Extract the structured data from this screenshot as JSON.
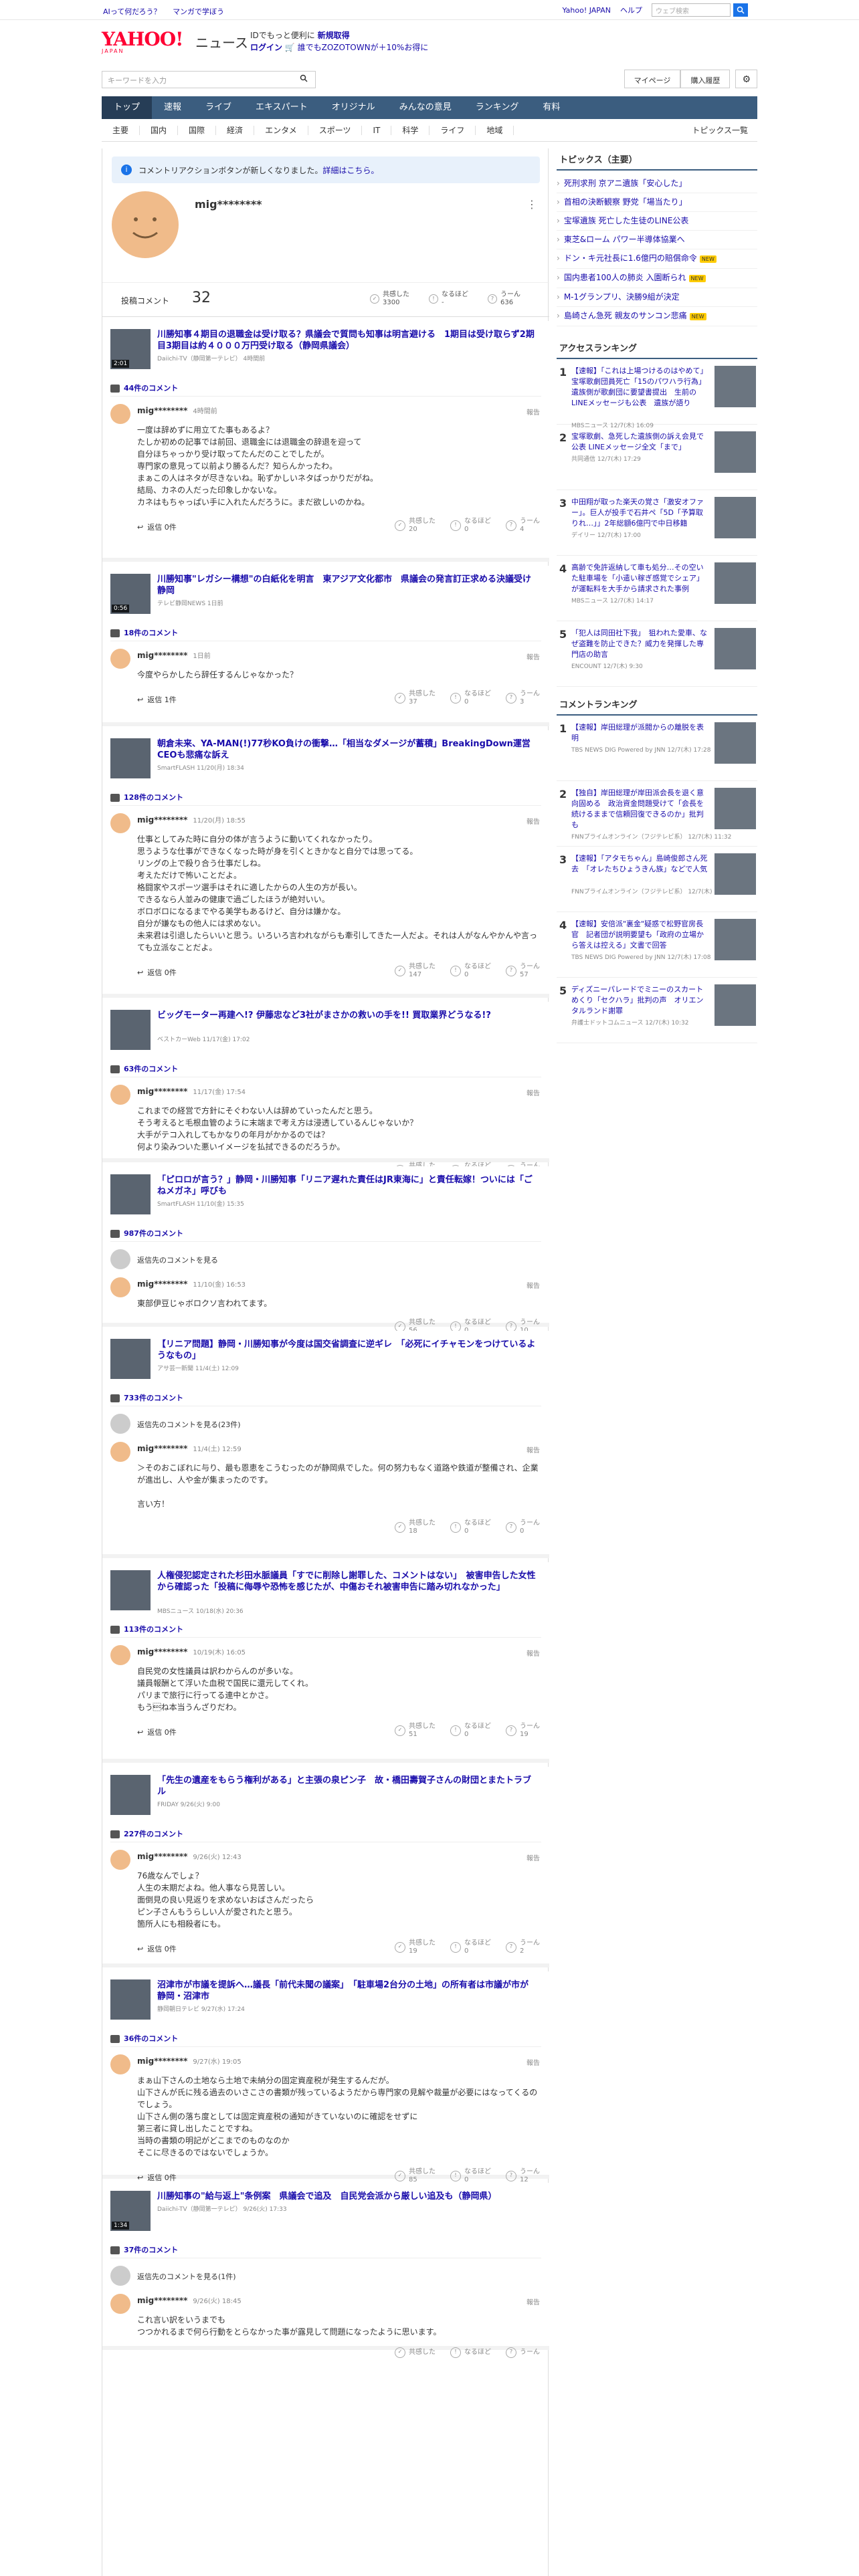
{
  "topbar": {
    "ai": "AIって何だろう？",
    "manga": "マンガで学ぼう",
    "yahoo_japan": "Yahoo! JAPAN",
    "help": "ヘルプ",
    "search_placeholder": "ウェブ検索"
  },
  "header": {
    "logo": "YAHOO!",
    "logo_sub": "JAPAN",
    "site": "ニュース",
    "promo1": "IDでもっと便利に",
    "promo1_link": "新規取得",
    "promo2_login": "ログイン",
    "promo2": "誰でもZOZOTOWNが＋10%お得に"
  },
  "search": {
    "placeholder": "キーワードを入力",
    "mypage": "マイページ",
    "purchase": "購入履歴"
  },
  "mainnav": [
    "トップ",
    "速報",
    "ライブ",
    "エキスパート",
    "オリジナル",
    "みんなの意見",
    "ランキング",
    "有料"
  ],
  "subnav": [
    "主要",
    "国内",
    "国際",
    "経済",
    "エンタメ",
    "スポーツ",
    "IT",
    "科学",
    "ライフ",
    "地域"
  ],
  "subnav_right": "トピックス一覧",
  "notice": {
    "text": "コメントリアクションボタンが新しくなりました。",
    "link": "詳細はこちら。"
  },
  "profile": {
    "name": "mig********",
    "count_label": "投稿コメント",
    "count": "32",
    "r1_label": "共感した",
    "r1_val": "3300",
    "r2_label": "なるほど",
    "r2_val": "-",
    "r3_label": "うーん",
    "r3_val": "636"
  },
  "common": {
    "report": "報告",
    "agree": "共感した",
    "hmm": "なるほど",
    "uun": "うーん",
    "prev": "返信先のコメントを見る"
  },
  "blocks": [
    {
      "title": "川勝知事４期目の退職金は受け取る？県議会で質問も知事は明言避ける　1期目は受け取らず2期目3期目は約４０００万円受け取る（静岡県議会）",
      "source": "Daiichi-TV（静岡第一テレビ）  4時間前",
      "dur": "2:01",
      "count": "44件のコメント",
      "user": "mig********",
      "time": "4時間前",
      "text": "一度は辞めずに用立てた事もあるよ？\nたしか初めの記事では前回、退職金には退職金の辞退を迎って\n自分ほちゃっかり受け取ってたんだのことでしたが。\n専門家の意見って以前より勝るんだ？知らんかったわ。\nまぁこの人はネタが尽きないね。恥ずかしいネタばっかりだがね。\n結局、カネの人だった印象しかないな。\nカネはもちゃっぱい手に入れたんだろうに。まだ欲しいのかね。",
      "reply": "返信 0件",
      "a": "20",
      "b": "0",
      "c": "4"
    },
    {
      "title": "川勝知事\"レガシー構想\"の白紙化を明言　東アジア文化都市　県議会の発言訂正求める決議受け　静岡",
      "source": "テレビ静岡NEWS  1日前",
      "dur": "0:56",
      "count": "18件のコメント",
      "user": "mig********",
      "time": "1日前",
      "text": "今度やらかしたら辞任するんじゃなかった？",
      "reply": "返信 1件",
      "a": "37",
      "b": "0",
      "c": "3"
    },
    {
      "title": "朝倉未来、YA-MAN(!)77秒KO負けの衝撃…「相当なダメージが蓄積」BreakingDown運営CEOも悲痛な訴え",
      "source": "SmartFLASH  11/20(月) 18:34",
      "dur": "",
      "count": "128件のコメント",
      "user": "mig********",
      "time": "11/20(月) 18:55",
      "text": "仕事としてみた時に自分の体が言うように動いてくれなかったり。\n思うような仕事ができなくなった時が身を引くときかなと自分では思ってる。\nリングの上で殺り合う仕事だしね。\n考えただけで怖いことだよ。\n格闘家やスポーツ選手はそれに適したからの人生の方が長い。\nできるなら人並みの健康で過ごしたほうが絶対いい。\nボロボロになるまでやる美学もあるけど、自分は嫌かな。\n自分が嫌なもの他人には求めない。\n未来君は引退したらいいと思う。いろいろ言われながらも牽引してきた一人だよ。それは人がなんやかんや言っても立派なことだよ。",
      "reply": "返信 0件",
      "a": "147",
      "b": "0",
      "c": "57"
    },
    {
      "title": "ビッグモーター再建へ!? 伊藤忠など3社がまさかの救いの手を!! 買取業界どうなる!?",
      "source": "ベストカーWeb  11/17(金) 17:02",
      "dur": "",
      "count": "63件のコメント",
      "user": "mig********",
      "time": "11/17(金) 17:54",
      "text": "これまでの経営で方針にそぐわない人は辞めていったんだと思う。\nそう考えると毛根血管のように末端まで考え方は浸透しているんじゃないか？\n大手がテコ入れしてもかなりの年月がかかるのでは？\n何より染みついた悪いイメージを払拭できるのだろうか。",
      "reply": "返信 1件",
      "a": "57",
      "b": "0",
      "c": "5"
    },
    {
      "title": "「ピロロが言う？」静岡・川勝知事「リニア遅れた責任はJR東海に」と責任転嫁！ついには「ごねメガネ」呼びも",
      "source": "SmartFLASH  11/10(金) 15:35",
      "dur": "",
      "count": "987件のコメント",
      "preview": true,
      "user": "mig********",
      "time": "11/10(金) 16:53",
      "text": "東部伊豆じゃボロクソ言われてます。",
      "reply": "",
      "a": "56",
      "b": "0",
      "c": "10"
    },
    {
      "title": "【リニア問題】静岡・川勝知事が今度は国交省調査に逆ギレ　「必死にイチャモンをつけているようなもの」",
      "source": "アサ芸一新聞  11/4(土) 12:09",
      "dur": "",
      "count": "733件のコメント",
      "preview": true,
      "preview_text": "返信先のコメントを見る(23件)",
      "user": "mig********",
      "time": "11/4(土) 12:59",
      "text": "＞そのおこぼれに与り、最も恩恵をこうむったのが静岡県でした。何の努力もなく道路や鉄道が整備され、企業が進出し、人や金が集まったのです。\n\n言い方！",
      "reply": "",
      "a": "18",
      "b": "0",
      "c": "0"
    },
    {
      "title": "人権侵犯認定された杉田水脈議員「すでに削除し謝罪した、コメントはない」　被害申告した女性から確認った「投稿に侮辱や恐怖を感じたが、中傷おそれ被害申告に踏み切れなかった」",
      "source": "MBSニュース  10/18(水) 20:36",
      "dur": "",
      "count": "113件のコメント",
      "user": "mig********",
      "time": "10/19(木) 16:05",
      "text": "自民党の女性議員は訳わからんのが多いな。\n議員報酬とて浮いた血税で国民に還元してくれ。\nパリまで旅行に行ってる連中とかさ。\nもう\u001bね本当うんざりだわ。",
      "reply": "返信 0件",
      "a": "51",
      "b": "0",
      "c": "19"
    },
    {
      "title": "「先生の遺産をもらう権利がある」と主張の泉ピン子　故・橋田壽賀子さんの財団とまたトラブル",
      "source": "FRIDAY  9/26(火) 9:00",
      "dur": "",
      "count": "227件のコメント",
      "user": "mig********",
      "time": "9/26(火) 12:43",
      "text": "76歳なんでしょ？\n人生の末期だよね。他人事なら見苦しい。\n面倒見の良い見返りを求めないおばさんだったら\nピン子さんもうらしい人が愛されたと思う。\n箇所人にも相殺者にも。",
      "reply": "返信 0件",
      "a": "19",
      "b": "0",
      "c": "2"
    },
    {
      "title": "沼津市が市議を提訴へ…議長「前代未聞の議案」　「駐車場2台分の土地」の所有者は市議が市が　静岡・沼津市",
      "source": "静岡朝日テレビ  9/27(水) 17:24",
      "dur": "",
      "count": "36件のコメント",
      "user": "mig********",
      "time": "9/27(水) 19:05",
      "text": "まぁ山下さんの土地なら土地で未納分の固定資産税が発生するんだが。\n山下さんが氏に残る過去のいさこさの書類が残っているようだから専門家の見解や裁量が必要にはなってくるのでしょう。\n山下さん側の落ち度としては固定資産税の通知がきていないのに確認をせずに\n第三者に貸し出したことですね。\n当時の書類の明記がどこまでのものなのか\nそこに尽きるのではないでしょうか。",
      "reply": "返信 0件",
      "a": "85",
      "b": "0",
      "c": "12"
    },
    {
      "title": "川勝知事の\"給与返上\"条例案　県議会で追及　自民党会派から厳しい追及も（静岡県）",
      "source": "Daiichi-TV（静岡第一テレビ）  9/26(火) 17:33",
      "dur": "1:34",
      "count": "37件のコメント",
      "preview": true,
      "preview_text": "返信先のコメントを見る(1件)",
      "user": "mig********",
      "time": "9/26(火) 18:45",
      "text": "これ言い訳をいうまでも\nつつかれるまで何ら行動をとらなかった事が露見して問題になったように思います。",
      "reply": "",
      "a": "",
      "b": "",
      "c": ""
    }
  ],
  "side": {
    "topics_head": "トピックス（主要）",
    "topics": [
      "死刑求刑 京アニ遺族「安心した」",
      "首相の決断観察 野党「場当たり」",
      "宝塚遺族 死亡した生徒のLINE公表",
      "東芝&ローム パワー半導体協業へ",
      "ドン・キ元社長に1.6億円の賠償命令",
      "国内患者100人の肺炎 入園断られ",
      "M-1グランプリ、決勝9組が決定",
      "島崎さん急死 親友のサンコン悲痛"
    ],
    "topics_new": [
      4,
      5,
      7
    ],
    "rank_head": "アクセスランキング",
    "access": [
      {
        "n": "1",
        "t": "【速報】「これは上場つけるのはやめて」宝塚歌劇団員死亡「15のパワハラ行為」遺族側が歌劇団に要望書提出　生前のLINEメッセージも公表　遺族が語り",
        "s": "MBSニュース 12/7(木) 16:09"
      },
      {
        "n": "2",
        "t": "宝塚歌劇、急死した遺族側の訴え会見で公表 LINEメッセージ全文「まで」",
        "s": "共同通信 12/7(木) 17:29"
      },
      {
        "n": "3",
        "t": "中田翔が取った楽天の覚さ「激安オファー」。巨人が投手で石井ペ「5D「予算取りれ…」」2年総額6億円で中日移籍",
        "s": "デイリー 12/7(木) 17:00"
      },
      {
        "n": "4",
        "t": "高齢で免許返納して車も処分…その空いた駐車場を「小遣い稼ぎ感覚でシェア」が運転料を大手から請求された事例",
        "s": "MBSニュース 12/7(木) 14:17"
      },
      {
        "n": "5",
        "t": "「犯人は同田社下我」　狙われた愛車、なぜ盗難を防止できた？威力を発揮した専門店の助言",
        "s": "ENCOUNT 12/7(木) 9:30"
      }
    ],
    "crank_head": "コメントランキング",
    "comments": [
      {
        "n": "1",
        "t": "【速報】岸田総理が派閥からの離脱を表明",
        "s": "TBS NEWS DIG Powered by JNN  12/7(木) 17:28"
      },
      {
        "n": "2",
        "t": "【独自】岸田総理が岸田派会長を退く意向固める　政治資金問題受けて「会長を続けるままで信頼回復できるのか」批判も",
        "s": "FNNプライムオンライン（フジテレビ系） 12/7(木) 11:32"
      },
      {
        "n": "3",
        "t": "【速報】「アタモちゃん」島崎俊郎さん死去　「オレたちひょうきん族」などで人気",
        "s": "FNNプライムオンライン（フジテレビ系） 12/7(木) 12:00"
      },
      {
        "n": "4",
        "t": "【速報】安倍派\"裏金\"疑惑で松野官房長官　記者団が説明要望も「政府の立場から答えは控える」文書で回答",
        "s": "TBS NEWS DIG Powered by JNN  12/7(木) 17:08"
      },
      {
        "n": "5",
        "t": "ディズニーパレードでミニーのスカートめくり「セクハラ」批判の声　オリエンタルランド謝罪",
        "s": "弁護士ドットコムニュース 12/7(木) 10:32"
      }
    ]
  }
}
